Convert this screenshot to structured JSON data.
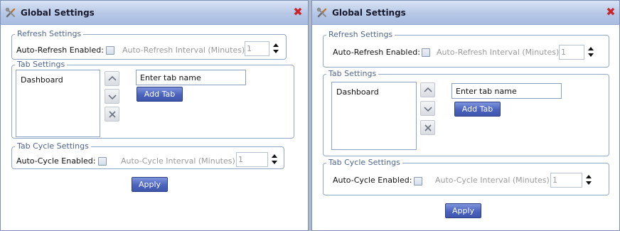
{
  "dialogs": [
    {
      "title": "Global Settings",
      "refresh": {
        "legend": "Refresh Settings",
        "enabled_label": "Auto-Refresh Enabled:",
        "interval_label": "Auto-Refresh Interval (Minutes):",
        "interval_value": "1"
      },
      "tabs": {
        "legend": "Tab Settings",
        "items": [
          "Dashboard"
        ],
        "input_value": "Enter tab name",
        "add_label": "Add Tab"
      },
      "cycle": {
        "legend": "Tab Cycle Settings",
        "enabled_label": "Auto-Cycle Enabled:",
        "interval_label": "Auto-Cycle Interval (Minutes):",
        "interval_value": "1"
      },
      "apply_label": "Apply"
    },
    {
      "title": "Global Settings",
      "refresh": {
        "legend": "Refresh Settings",
        "enabled_label": "Auto-Refresh Enabled:",
        "interval_label": "Auto-Refresh Interval (Minutes):",
        "interval_value": "1"
      },
      "tabs": {
        "legend": "Tab Settings",
        "items": [
          "Dashboard"
        ],
        "input_value": "Enter tab name",
        "add_label": "Add Tab"
      },
      "cycle": {
        "legend": "Tab Cycle Settings",
        "enabled_label": "Auto-Cycle Enabled:",
        "interval_label": "Auto-Cycle Interval (Minutes):",
        "interval_value": "1"
      },
      "apply_label": "Apply"
    }
  ],
  "icons": {
    "title": "tools-icon",
    "close": "close-icon",
    "move_up": "move-up-icon",
    "move_down": "move-down-icon",
    "remove": "remove-icon"
  },
  "colors": {
    "titlebar": "#b6c7e6",
    "close": "#c8262b",
    "legend_text": "#4f6690",
    "button": "#4b63bd"
  }
}
